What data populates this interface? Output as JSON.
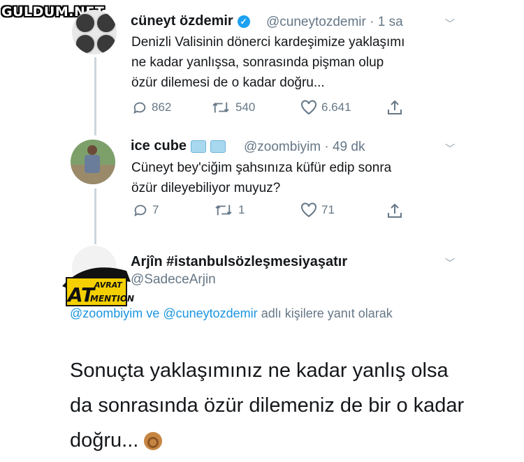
{
  "watermark": "GULDUM.NET",
  "tweets": [
    {
      "name": "cüneyt özdemir",
      "handle": "@cuneytozdemir",
      "time": "· 1 sa",
      "lines": [
        "Denizli Valisinin dönerci kardeşimize yaklaşımı",
        "ne kadar yanlışsa, sonrasında pişman olup",
        "özür dilemesi de o kadar doğru..."
      ],
      "replies": "862",
      "retweets": "540",
      "likes": "6.641"
    },
    {
      "name": "ice cube",
      "handle": "@zoombiyim",
      "time": "· 49 dk",
      "lines": [
        "Cüneyt bey'ciğim şahsınıza küfür edip sonra",
        "özür dileyebiliyor muyuz?"
      ],
      "replies": "7",
      "retweets": "1",
      "likes": "71"
    }
  ],
  "main_tweet": {
    "name": "Arjîn #istanbulsözleşmesiyaşatır",
    "handle": "@SadeceArjin",
    "avatar_logo_top": "AVRAT",
    "avatar_logo_big": "AT",
    "avatar_logo_bottom": "MENTION",
    "reply_mention_1": "@zoombiyim",
    "reply_and": "ve",
    "reply_mention_2": "@cuneytozdemir",
    "reply_suffix": "adlı kişilere yanıt olarak",
    "text": "Sonuçta yaklaşımınız ne kadar yanlış olsa da sonrasında özür dilemeniz de bir o kadar doğru..."
  },
  "icons": {
    "verified": "verified-badge-icon",
    "ice": "ice-cube-emoji-icon",
    "ok": "ok-hand-emoji-icon"
  },
  "colors": {
    "accent": "#1b95e0",
    "muted": "#657786",
    "verified": "#1da1f2"
  }
}
